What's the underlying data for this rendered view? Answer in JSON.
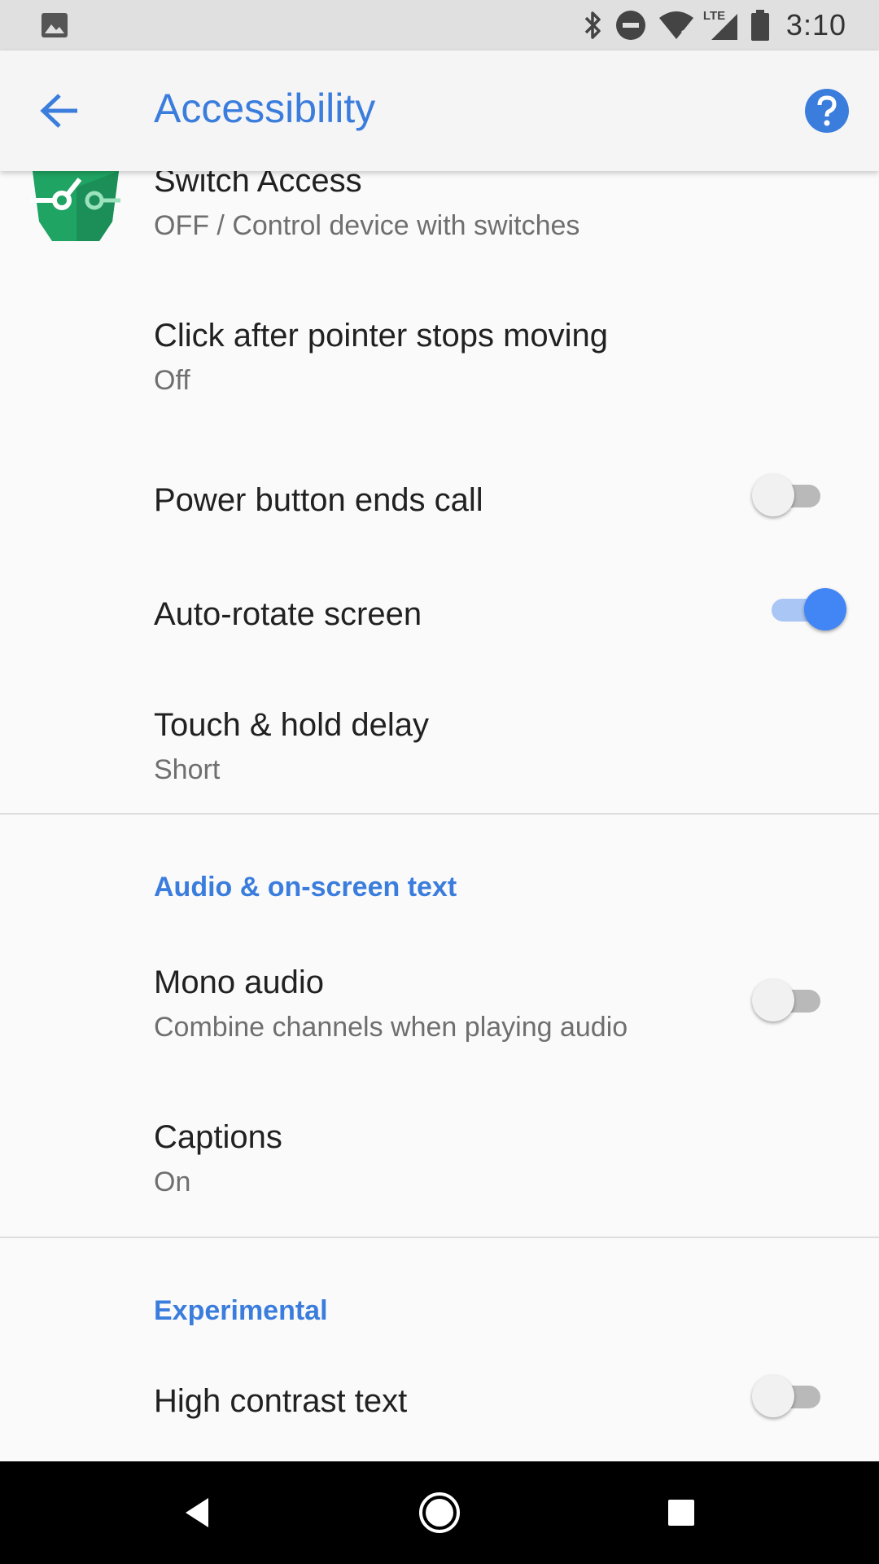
{
  "status_bar": {
    "time": "3:10",
    "network_label": "LTE"
  },
  "app_bar": {
    "title": "Accessibility"
  },
  "items": {
    "switch_access": {
      "title": "Switch Access",
      "subtitle": "OFF / Control device with switches"
    },
    "click_after_pointer": {
      "title": "Click after pointer stops moving",
      "subtitle": "Off"
    },
    "power_button": {
      "title": "Power button ends call",
      "enabled": false
    },
    "auto_rotate": {
      "title": "Auto-rotate screen",
      "enabled": true
    },
    "touch_hold": {
      "title": "Touch & hold delay",
      "subtitle": "Short"
    }
  },
  "sections": {
    "audio": {
      "header": "Audio & on-screen text",
      "mono_audio": {
        "title": "Mono audio",
        "subtitle": "Combine channels when playing audio",
        "enabled": false
      },
      "captions": {
        "title": "Captions",
        "subtitle": "On"
      }
    },
    "experimental": {
      "header": "Experimental",
      "high_contrast": {
        "title": "High contrast text",
        "enabled": false
      }
    }
  },
  "colors": {
    "accent": "#3b7ddd",
    "switch_on": "#4285f4",
    "switch_access_icon": "#1fa463"
  }
}
